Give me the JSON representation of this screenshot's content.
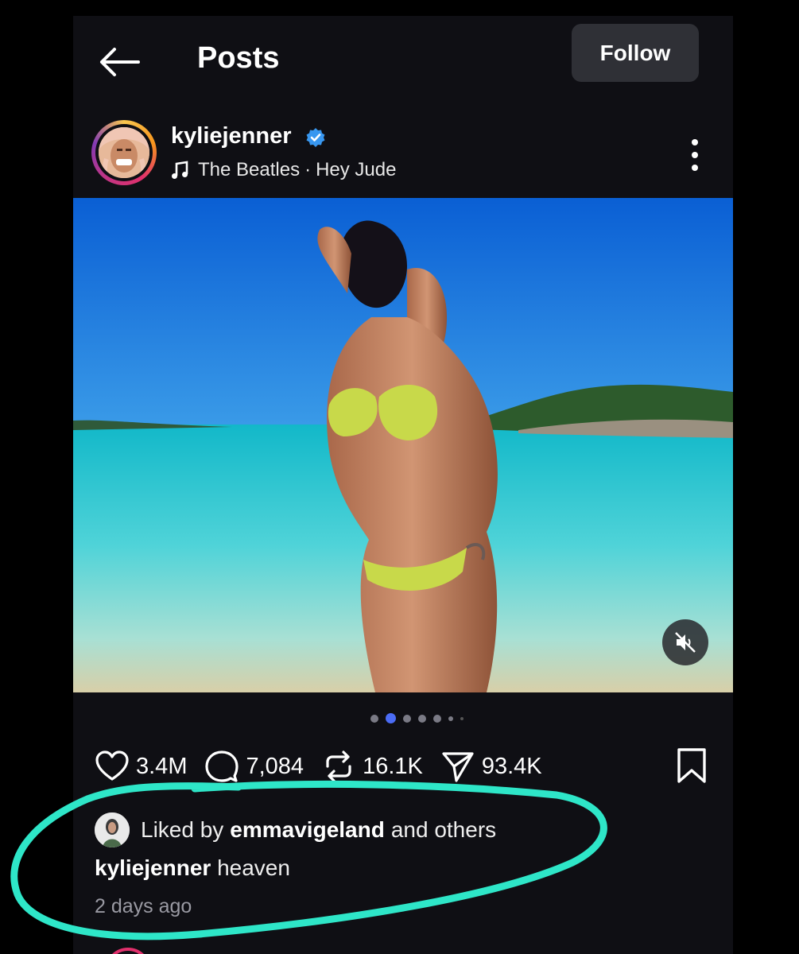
{
  "header": {
    "title": "Posts",
    "follow_label": "Follow"
  },
  "post": {
    "username": "kyliejenner",
    "music": {
      "artist": "The Beatles",
      "separator": "·",
      "track": "Hey Jude"
    },
    "carousel": {
      "count": 7,
      "active_index": 1
    },
    "stats": {
      "likes": "3.4M",
      "comments": "7,084",
      "reposts": "16.1K",
      "shares": "93.4K"
    },
    "liked_by": {
      "prefix": "Liked by",
      "user": "emmavigeland",
      "suffix": "and others"
    },
    "caption": {
      "user": "kyliejenner",
      "text": "heaven"
    },
    "timestamp": "2 days ago"
  },
  "colors": {
    "background": "#0f0f14",
    "follow_button": "#2f3036",
    "verified_badge": "#3897f0",
    "active_dot": "#4b6cf5",
    "annotation": "#2ee6c8"
  },
  "icons": [
    "back-arrow-icon",
    "verified-badge-icon",
    "music-note-icon",
    "more-vertical-icon",
    "mute-icon",
    "heart-icon",
    "comment-icon",
    "repost-icon",
    "share-icon",
    "bookmark-icon"
  ]
}
